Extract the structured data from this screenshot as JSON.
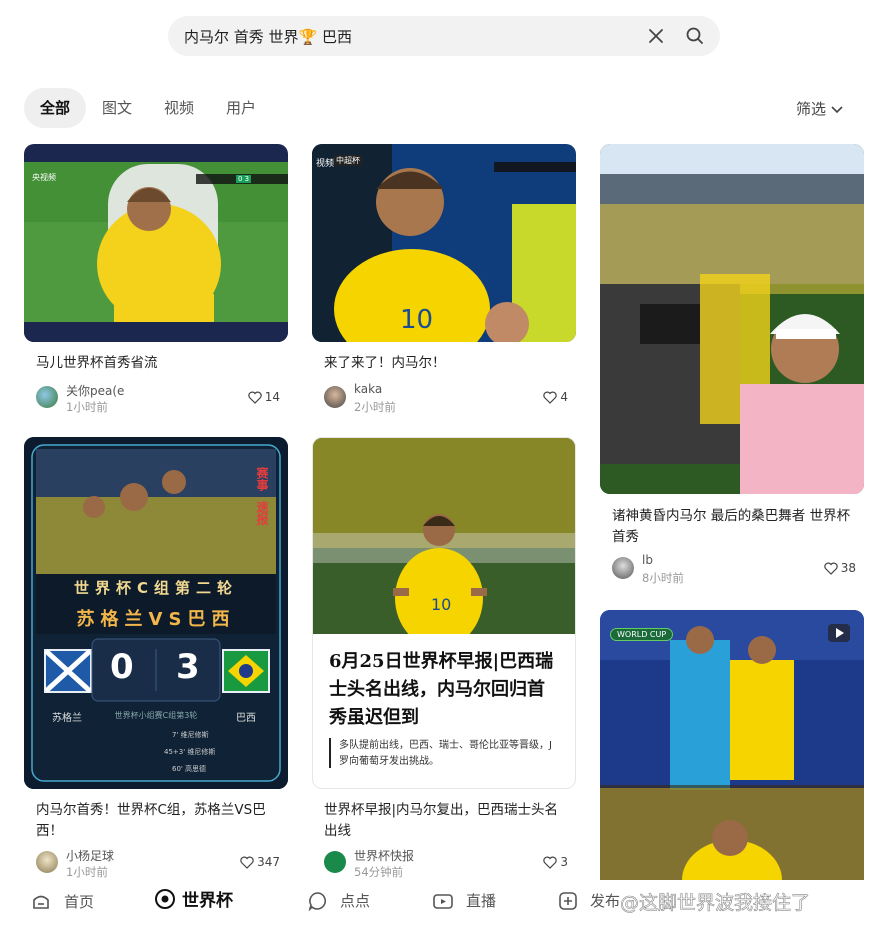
{
  "search": {
    "query": "内马尔 首秀 世界🏆 巴西"
  },
  "tabs": [
    "全部",
    "图文",
    "视频",
    "用户"
  ],
  "filter_label": "筛选",
  "cards": [
    {
      "title": "马儿世界杯首秀省流",
      "author": "关你pea(e",
      "time": "1小时前",
      "likes": "14",
      "overlay": {
        "live": "央视频",
        "score": "0 3"
      }
    },
    {
      "title": "来了来了！内马尔！",
      "author": "kaka",
      "time": "2小时前",
      "likes": "4",
      "overlay": {
        "video": "视频",
        "cctv": "中超杯"
      }
    },
    {
      "title": "诸神黄昏内马尔 最后的桑巴舞者 世界杯首秀",
      "author": "lb",
      "time": "8小时前",
      "likes": "38"
    },
    {
      "title": "内马尔首秀！世界杯C组，苏格兰VS巴西！",
      "author": "小杨足球",
      "time": "1小时前",
      "likes": "347",
      "overlay": {
        "badge_top": "赛事",
        "badge_bottom": "速报",
        "group_line": "世界杯C组第二轮",
        "match_line": "苏格兰VS巴西",
        "home_score": "0",
        "away_score": "3",
        "home_name": "苏格兰",
        "away_name": "巴西",
        "sub": "世界杯小组赛C组第3轮",
        "events": [
          "7'  维尼修斯",
          "45+3'  维尼修斯",
          "60'  高思德"
        ]
      }
    },
    {
      "title": "世界杯早报|内马尔复出，巴西瑞士头名出线",
      "author": "世界杯快报",
      "time": "54分钟前",
      "likes": "3",
      "overlay": {
        "headline": "6月25日世界杯早报|巴西瑞士头名出线，内马尔回归首秀虽迟但到",
        "body": "多队提前出线，巴西、瑞士、哥伦比亚等晋级，J罗向葡萄牙发出挑战。"
      }
    },
    {
      "title": "",
      "author": "",
      "time": "",
      "likes": "",
      "overlay": {
        "badge": "WORLD CUP"
      }
    }
  ],
  "bottom_nav": {
    "home": "首页",
    "brand": "世界杯",
    "dots": "点点",
    "live": "直播",
    "post": "发布",
    "watermark": "@这脚世界波我接住了"
  },
  "colors": {
    "brand_green": "#1aa05a",
    "brand_red": "#e23d3d",
    "brazil_yellow": "#f5d400"
  }
}
